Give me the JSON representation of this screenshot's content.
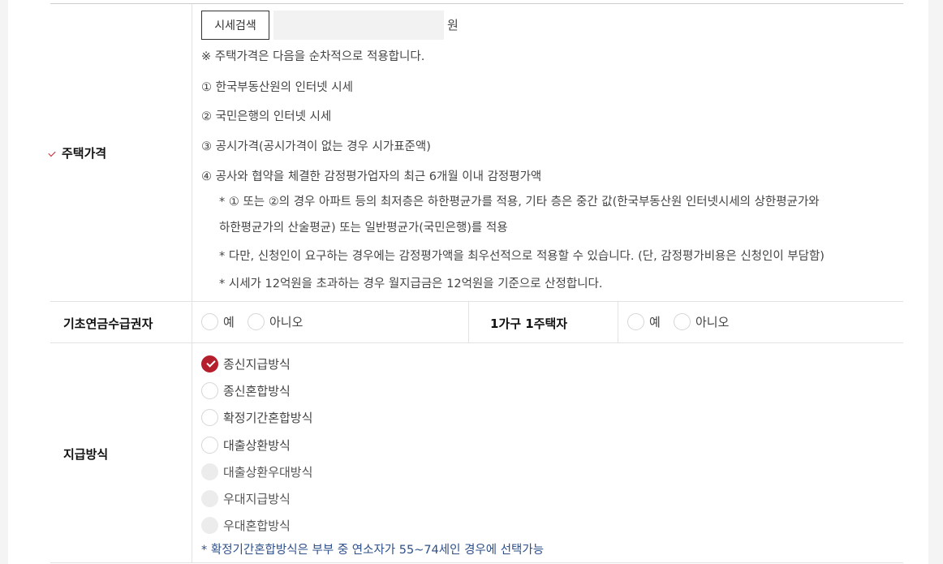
{
  "house_price": {
    "label": "주택가격",
    "search_button": "시세검색",
    "input_value": "",
    "unit": "원",
    "intro": "※ 주택가격은 다음을 순차적으로 적용합니다.",
    "items": [
      "① 한국부동산원의 인터넷 시세",
      "② 국민은행의 인터넷 시세",
      "③ 공시가격(공시가격이 없는 경우 시가표준액)",
      "④ 공사와 협약을 체결한 감정평가업자의 최근 6개월 이내 감정평가액"
    ],
    "notes": [
      "* ① 또는 ②의 경우 아파트 등의 최저층은 하한평균가를 적용, 기타 층은 중간 값(한국부동산원 인터넷시세의 상한평균가와",
      "하한평균가의 산술평균) 또는 일반평균가(국민은행)를 적용",
      "* 다만, 신청인이 요구하는 경우에는 감정평가액을 최우선적으로 적용할 수 있습니다. (단, 감정평가비용은 신청인이 부담함)",
      "* 시세가 12억원을 초과하는 경우 월지급금은 12억원을 기준으로 산정합니다."
    ]
  },
  "basic_pension": {
    "label": "기초연금수급권자",
    "options": [
      "예",
      "아니오"
    ]
  },
  "one_house": {
    "label": "1가구 1주택자",
    "options": [
      "예",
      "아니오"
    ]
  },
  "payment_method": {
    "label": "지급방식",
    "options": [
      {
        "label": "종신지급방식",
        "state": "checked"
      },
      {
        "label": "종신혼합방식",
        "state": "enabled"
      },
      {
        "label": "확정기간혼합방식",
        "state": "enabled"
      },
      {
        "label": "대출상환방식",
        "state": "enabled"
      },
      {
        "label": "대출상환우대방식",
        "state": "disabled"
      },
      {
        "label": "우대지급방식",
        "state": "disabled"
      },
      {
        "label": "우대혼합방식",
        "state": "disabled"
      }
    ],
    "note": "* 확정기간혼합방식은 부부 중 연소자가 55~74세인 경우에 선택가능"
  },
  "colors": {
    "accent_red": "#b51f2d",
    "note_blue": "#2d4f8a"
  }
}
